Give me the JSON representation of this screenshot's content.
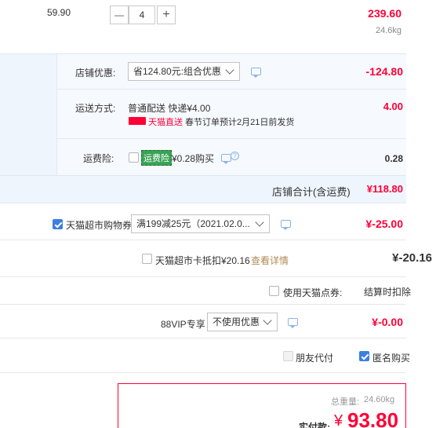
{
  "item": {
    "unit_price": "59.90",
    "quantity": "4",
    "minus_symbol": "—",
    "plus_symbol": "+",
    "subtotal": "239.60",
    "weight": "24.6kg"
  },
  "store": {
    "discount_label": "店铺优惠:",
    "discount_option": "省124.80元:组合优惠",
    "discount_amount": "-124.80",
    "shipping_label": "运送方式:",
    "shipping_method": "普通配送 快递¥4.00",
    "shipping_badge": "天猫直送",
    "shipping_note": "春节订单预计2月21日前发货",
    "shipping_amount": "4.00",
    "insurance_label": "运费险:",
    "insurance_tag": "运费险",
    "insurance_price": "¥0.28购买",
    "insurance_amount": "0.28",
    "total_label": "店铺合计(含运费)",
    "total_amount": "¥118.80"
  },
  "coupons": {
    "supermarket_coupon_label": "天猫超市购物券",
    "supermarket_coupon_option": "满199减25元（2021.02.0...",
    "supermarket_coupon_amount": "¥-25.00",
    "card_label": "天猫超市卡抵扣¥20.16",
    "card_link": "查看详情",
    "card_amount": "¥-20.16",
    "points_label": "使用天猫点券:",
    "points_note": "结算时扣除",
    "vip_label": "88VIP专享",
    "vip_option": "不使用优惠",
    "vip_amount": "¥-0.00"
  },
  "options": {
    "friend_pay_label": "朋友代付",
    "anonymous_label": "匿名购买"
  },
  "summary": {
    "weight_label": "总重量:",
    "weight_value": "24.60kg",
    "pay_label": "实付款:",
    "currency": "¥",
    "pay_amount": "93.80"
  },
  "colors": {
    "accent_red": "#ff0036",
    "store_bg": "#eef5fc",
    "checkbox_blue": "#3b7fe0"
  }
}
